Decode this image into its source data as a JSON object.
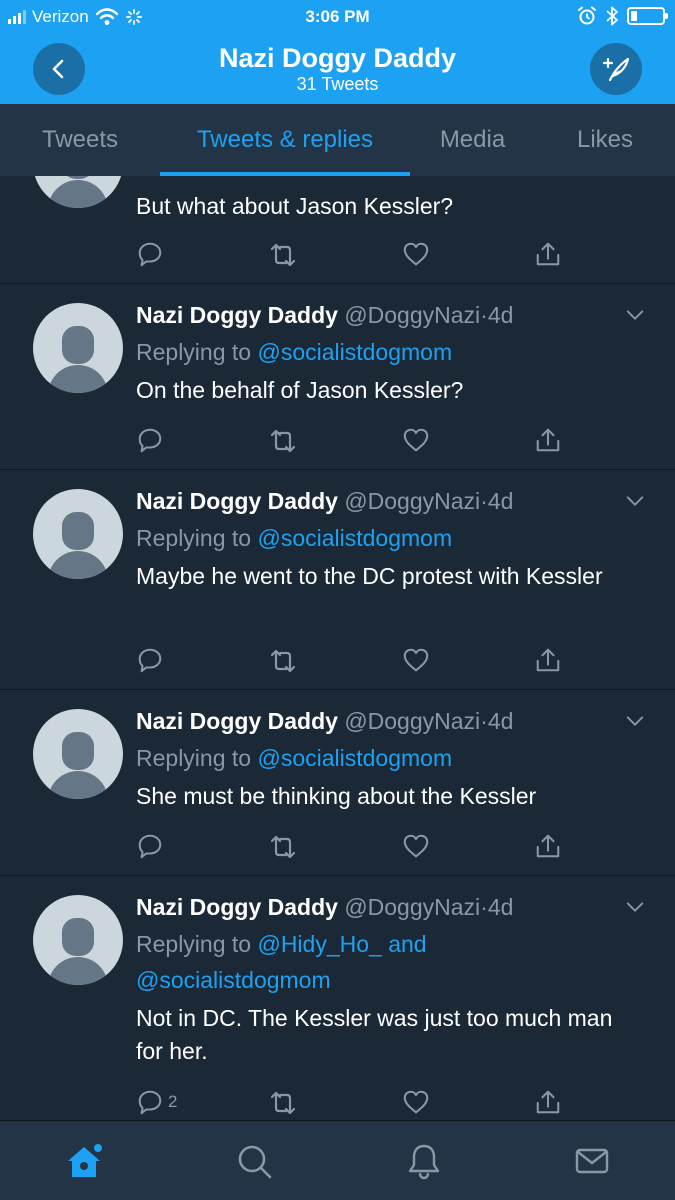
{
  "status_bar": {
    "carrier": "Verizon",
    "time": "3:06 PM",
    "battery_level": 0.2,
    "signal_bars_filled": 3
  },
  "header": {
    "title": "Nazi Doggy Daddy",
    "subtitle": "31 Tweets"
  },
  "tabs": [
    {
      "label": "Tweets",
      "active": false
    },
    {
      "label": "Tweets & replies",
      "active": true
    },
    {
      "label": "Media",
      "active": false
    },
    {
      "label": "Likes",
      "active": false
    }
  ],
  "tweets": [
    {
      "partial": true,
      "text": "But what about Jason Kessler?"
    },
    {
      "name": "Nazi Doggy Daddy",
      "handle": "@DoggyNazi",
      "dot": "·",
      "ago": "4d",
      "replying_prefix": "Replying to",
      "mentions": "@socialistdogmom",
      "text": "On the behalf of Jason Kessler?"
    },
    {
      "name": "Nazi Doggy Daddy",
      "handle": "@DoggyNazi",
      "dot": "·",
      "ago": "4d",
      "replying_prefix": "Replying to",
      "mentions": "@socialistdogmom",
      "text": "Maybe he went to the DC protest with Kessler"
    },
    {
      "name": "Nazi Doggy Daddy",
      "handle": "@DoggyNazi",
      "dot": "·",
      "ago": "4d",
      "replying_prefix": "Replying to",
      "mentions": "@socialistdogmom",
      "text": "She must be thinking about the Kessler"
    },
    {
      "name": "Nazi Doggy Daddy",
      "handle": "@DoggyNazi",
      "dot": "·",
      "ago": "4d",
      "replying_prefix": "Replying to",
      "mention_1": "@Hidy_Ho_",
      "mention_joiner": "and",
      "mention_2": "@socialistdogmom",
      "text": "Not in DC.  The Kessler was just too much man for her.",
      "reply_count": "2"
    }
  ],
  "icons": {
    "back": "back-arrow-icon",
    "compose": "compose-tweet-icon",
    "reply": "reply-icon",
    "retweet": "retweet-icon",
    "like": "heart-icon",
    "share": "share-icon",
    "caret": "chevron-down-icon",
    "home": "home-icon",
    "search": "search-icon",
    "notifications": "bell-icon",
    "messages": "mail-icon"
  },
  "colors": {
    "accent": "#1da1f2",
    "background": "#1b2836",
    "secondary_text": "#8899a6"
  }
}
